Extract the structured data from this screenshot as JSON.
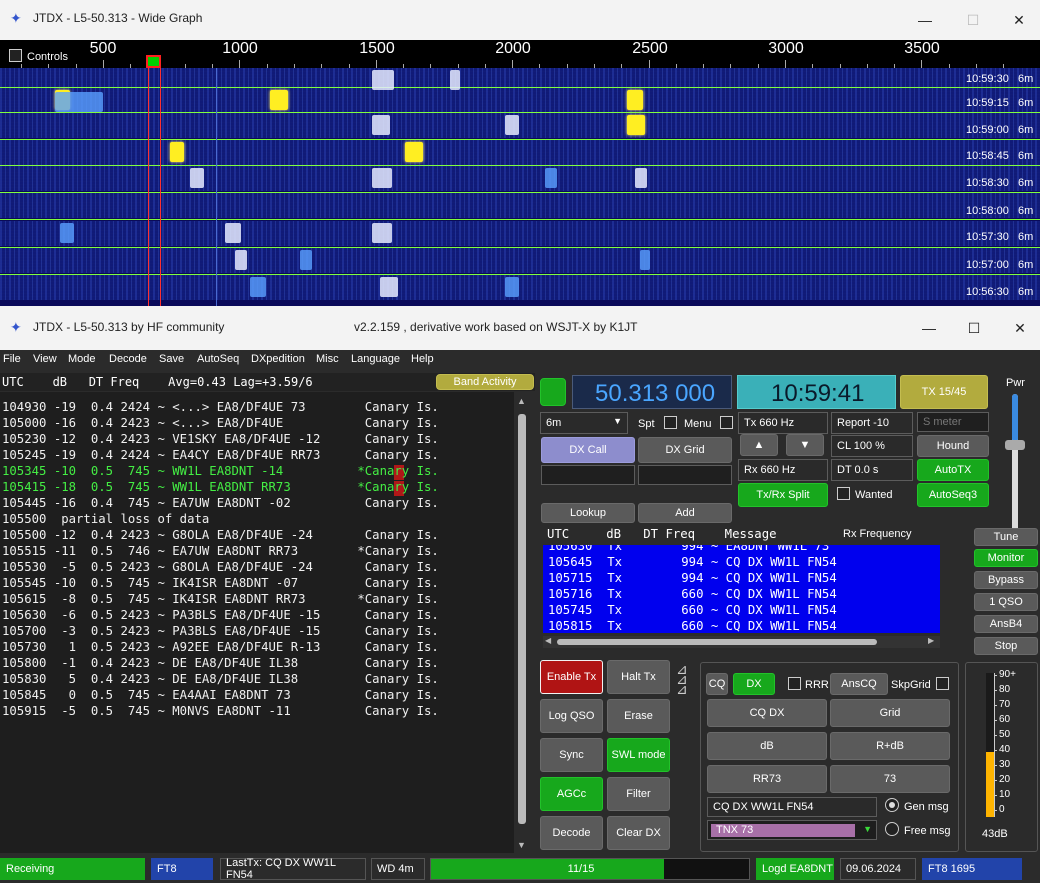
{
  "wide_graph": {
    "title": "JTDX - L5-50.313 - Wide Graph",
    "controls_label": "Controls",
    "freq_labels": [
      "500",
      "1000",
      "1500",
      "2000",
      "2500",
      "3000",
      "3500"
    ],
    "time_rows": [
      {
        "time": "10:59:30",
        "band": "6m"
      },
      {
        "time": "10:59:15",
        "band": "6m"
      },
      {
        "time": "10:59:00",
        "band": "6m"
      },
      {
        "time": "10:58:45",
        "band": "6m"
      },
      {
        "time": "10:58:30",
        "band": "6m"
      },
      {
        "time": "10:58:00",
        "band": "6m"
      },
      {
        "time": "10:57:30",
        "band": "6m"
      },
      {
        "time": "10:57:00",
        "band": "6m"
      },
      {
        "time": "10:56:30",
        "band": "6m"
      }
    ]
  },
  "main_window": {
    "title": "JTDX - L5-50.313  by HF community",
    "version": "v2.2.159 , derivative work based on WSJT-X by K1JT"
  },
  "menu": [
    "File",
    "View",
    "Mode",
    "Decode",
    "Save",
    "AutoSeq",
    "DXpedition",
    "Misc",
    "Language",
    "Help"
  ],
  "decode_header": "UTC    dB   DT Freq    Avg=0.43 Lag=+3.59/6",
  "band_activity_label": "Band Activity",
  "decodes": [
    {
      "text": "104930 -19  0.4 2424 ~ <...> EA8/DF4UE 73        Canary Is.",
      "color": "white",
      "marker": false
    },
    {
      "text": "105000 -16  0.4 2423 ~ <...> EA8/DF4UE           Canary Is.",
      "color": "white",
      "marker": false
    },
    {
      "text": "105230 -12  0.4 2423 ~ VE1SKY EA8/DF4UE -12      Canary Is.",
      "color": "white",
      "marker": false
    },
    {
      "text": "105245 -19  0.4 2424 ~ EA4CY EA8/DF4UE RR73      Canary Is.",
      "color": "white",
      "marker": false
    },
    {
      "text": "105345 -10  0.5  745 ~ WW1L EA8DNT -14          *Canary Is.",
      "color": "green",
      "marker": true
    },
    {
      "text": "105415 -18  0.5  745 ~ WW1L EA8DNT RR73         *Canary Is.",
      "color": "green",
      "marker": true
    },
    {
      "text": "105445 -16  0.4  745 ~ EA7UW EA8DNT -02          Canary Is.",
      "color": "white",
      "marker": false
    },
    {
      "text": "105500  partial loss of data",
      "color": "white",
      "marker": false
    },
    {
      "text": "105500 -12  0.4 2423 ~ G8OLA EA8/DF4UE -24       Canary Is.",
      "color": "white",
      "marker": false
    },
    {
      "text": "105515 -11  0.5  746 ~ EA7UW EA8DNT RR73        *Canary Is.",
      "color": "white",
      "marker": false
    },
    {
      "text": "105530  -5  0.5 2423 ~ G8OLA EA8/DF4UE -24       Canary Is.",
      "color": "white",
      "marker": false
    },
    {
      "text": "105545 -10  0.5  745 ~ IK4ISR EA8DNT -07         Canary Is.",
      "color": "white",
      "marker": false
    },
    {
      "text": "105615  -8  0.5  745 ~ IK4ISR EA8DNT RR73       *Canary Is.",
      "color": "white",
      "marker": false
    },
    {
      "text": "105630  -6  0.5 2423 ~ PA3BLS EA8/DF4UE -15      Canary Is.",
      "color": "white",
      "marker": false
    },
    {
      "text": "105700  -3  0.5 2423 ~ PA3BLS EA8/DF4UE -15      Canary Is.",
      "color": "white",
      "marker": false
    },
    {
      "text": "105730   1  0.5 2423 ~ A92EE EA8/DF4UE R-13      Canary Is.",
      "color": "white",
      "marker": false
    },
    {
      "text": "105800  -1  0.4 2423 ~ DE EA8/DF4UE IL38         Canary Is.",
      "color": "white",
      "marker": false
    },
    {
      "text": "105830   5  0.4 2423 ~ DE EA8/DF4UE IL38         Canary Is.",
      "color": "white",
      "marker": false
    },
    {
      "text": "105845   0  0.5  745 ~ EA4AAI EA8DNT 73          Canary Is.",
      "color": "white",
      "marker": false
    },
    {
      "text": "105915  -5  0.5  745 ~ M0NVS EA8DNT -11          Canary Is.",
      "color": "white",
      "marker": false
    }
  ],
  "controls": {
    "frequency": "50.313 000",
    "clock": "10:59:41",
    "tx_period": "TX 15/45",
    "pwr_label": "Pwr",
    "band": "6m",
    "spt": "Spt",
    "menu": "Menu",
    "tx_freq": "Tx  660  Hz",
    "report": "Report -10",
    "s_meter_placeholder": "S meter",
    "dx_call_btn": "DX Call",
    "dx_grid_btn": "DX Grid",
    "cl": "CL  100 %",
    "hound": "Hound",
    "up_arrow": "▲",
    "down_arrow": "▼",
    "rx_freq": "Rx  660  Hz",
    "dt": "DT 0.0 s",
    "autotx": "AutoTX",
    "txrx_split": "Tx/Rx Split",
    "wanted": "Wanted",
    "autoseq3": "AutoSeq3",
    "lookup": "Lookup",
    "add": "Add"
  },
  "rx_freq_header": "UTC     dB   DT Freq    Message",
  "rx_freq_label": "Rx Frequency",
  "rx_rows": [
    "105630  Tx        994 ~ EA8DNT WW1L 73",
    "105645  Tx        994 ~ CQ DX WW1L FN54",
    "105715  Tx        994 ~ CQ DX WW1L FN54",
    "105716  Tx        660 ~ CQ DX WW1L FN54",
    "105745  Tx        660 ~ CQ DX WW1L FN54",
    "105815  Tx        660 ~ CQ DX WW1L FN54"
  ],
  "side_buttons": [
    "Tune",
    "Monitor",
    "Bypass",
    "1 QSO",
    "AnsB4",
    "Stop"
  ],
  "left_buttons": {
    "enable_tx": "Enable Tx",
    "halt_tx": "Halt Tx",
    "log_qso": "Log QSO",
    "erase": "Erase",
    "sync": "Sync",
    "swl_mode": "SWL mode",
    "agcc": "AGCc",
    "filter": "Filter",
    "decode": "Decode",
    "clear_dx": "Clear DX"
  },
  "tx_panel": {
    "cq": "CQ",
    "dx": "DX",
    "rrr": "RRR",
    "anscq": "AnsCQ",
    "skpgrid": "SkpGrid",
    "cq_dx": "CQ DX",
    "grid": "Grid",
    "db": "dB",
    "r_db": "R+dB",
    "rr73": "RR73",
    "seventy_three": "73",
    "gen_msg_value": "CQ DX WW1L FN54",
    "free_msg_value": "TNX 73",
    "gen_msg": "Gen msg",
    "free_msg": "Free msg"
  },
  "meter": {
    "labels": [
      "90+",
      "80",
      "70",
      "60",
      "50",
      "40",
      "30",
      "20",
      "10",
      "0"
    ],
    "level_db": 43,
    "readout": "43dB",
    "color": "#ffb400"
  },
  "status": {
    "receiving": "Receiving",
    "mode": "FT8",
    "last_tx": "LastTx: CQ DX WW1L FN54",
    "wd": "WD 4m",
    "progress_text": "11/15",
    "progress_fraction": 0.733,
    "logged": "Logd EA8DNT",
    "date": "09.06.2024",
    "mode_freq": "FT8  1695"
  },
  "colors": {
    "freq_display_bg": "#1a2a4a",
    "freq_text": "#4aa6ff",
    "clock_bg": "#3ab0b8",
    "accent_green": "#17a81c",
    "rx_list_bg": "#0000ee",
    "waterfall_line": "#7fff3f"
  }
}
